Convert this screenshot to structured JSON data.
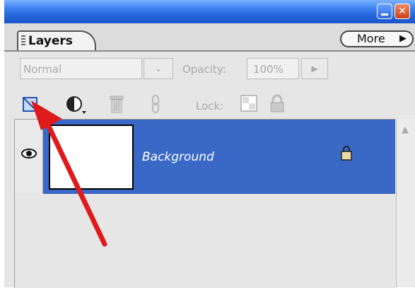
{
  "panel": {
    "tab_label": "Layers",
    "more_label": "More",
    "blend_mode": "Normal",
    "opacity_label": "Opacity:",
    "opacity_value": "100%",
    "lock_label": "Lock:"
  },
  "layers": [
    {
      "name": "Background",
      "visible": true,
      "locked": true,
      "selected": true
    }
  ],
  "colors": {
    "title_bar": "#2362d9",
    "selected_layer": "#3a68c6",
    "annotation_arrow": "#e0191b"
  },
  "icons": [
    "minimize-icon",
    "close-icon",
    "new-layer-icon",
    "adjustment-layer-icon",
    "trash-icon",
    "link-icon",
    "lock-transparency-icon",
    "lock-all-icon",
    "eye-icon",
    "padlock-icon",
    "scroll-up-icon"
  ]
}
